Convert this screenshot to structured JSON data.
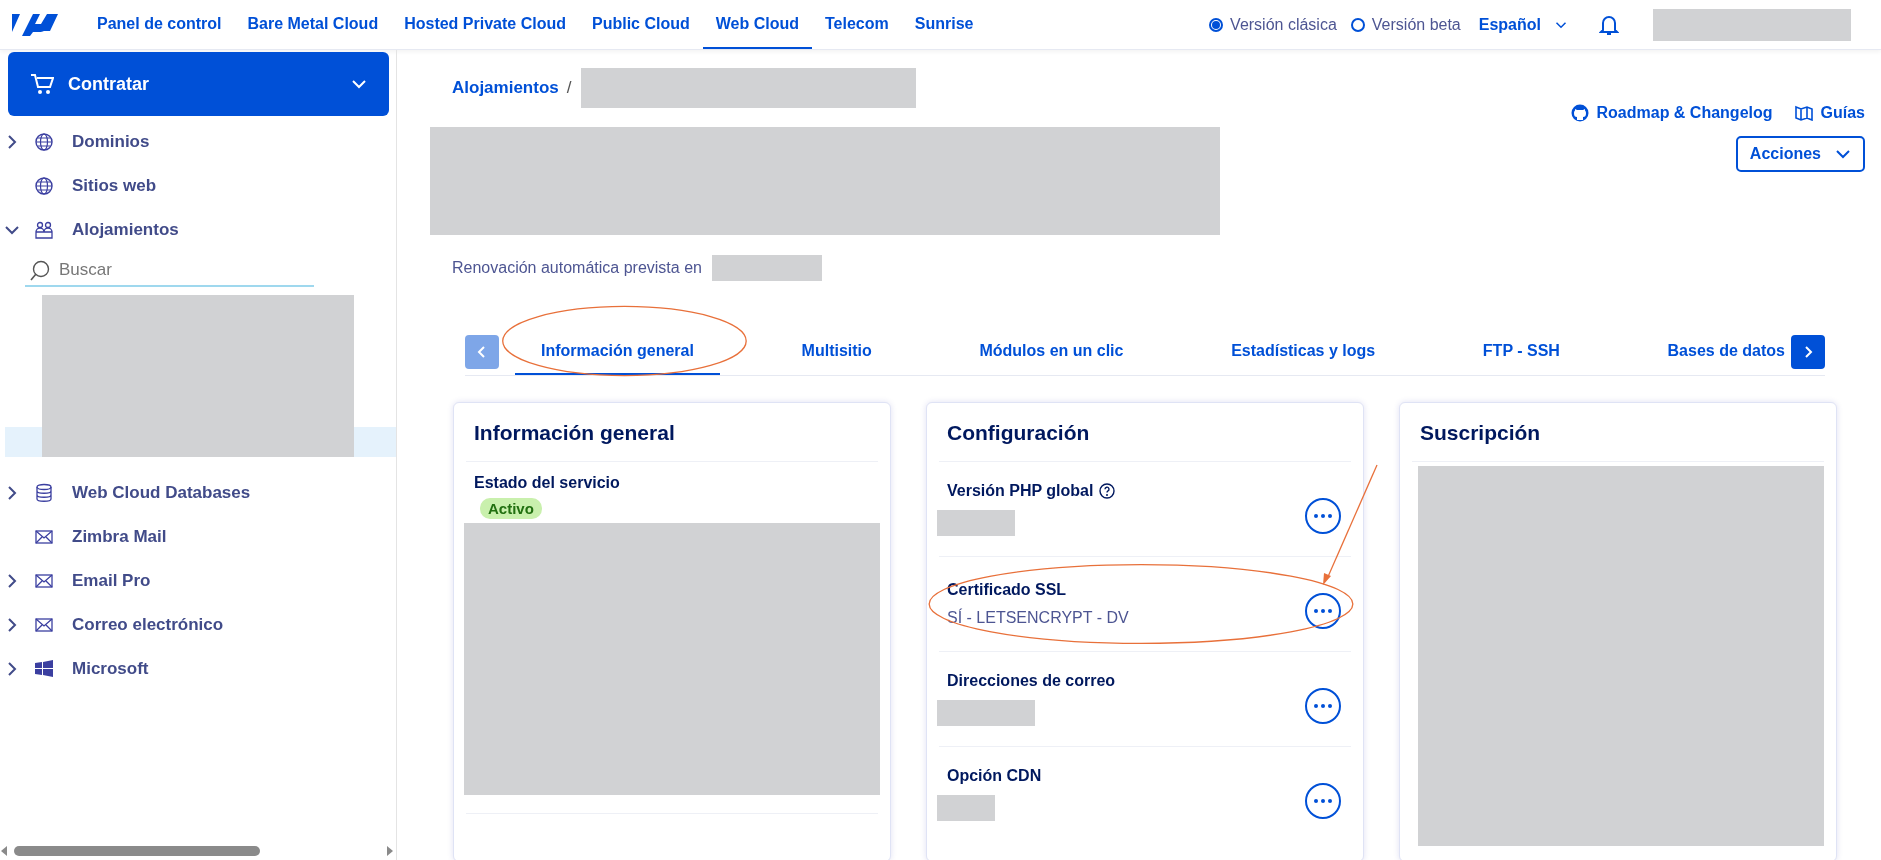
{
  "nav": {
    "items": [
      {
        "label": "Panel de control",
        "selected": false
      },
      {
        "label": "Bare Metal Cloud",
        "selected": false
      },
      {
        "label": "Hosted Private Cloud",
        "selected": false
      },
      {
        "label": "Public Cloud",
        "selected": false
      },
      {
        "label": "Web Cloud",
        "selected": true
      },
      {
        "label": "Telecom",
        "selected": false
      },
      {
        "label": "Sunrise",
        "selected": false
      }
    ],
    "version_options": [
      {
        "label": "Versión clásica",
        "selected": true
      },
      {
        "label": "Versión beta",
        "selected": false
      }
    ],
    "language": "Español"
  },
  "sidebar": {
    "order_button": "Contratar",
    "items": [
      {
        "label": "Dominios",
        "kind": "globe",
        "expandable": true,
        "expanded": false
      },
      {
        "label": "Sitios web",
        "kind": "globe",
        "expandable": false
      },
      {
        "label": "Alojamientos",
        "kind": "people",
        "expandable": true,
        "expanded": true,
        "search_placeholder": "Buscar"
      },
      {
        "label": "Web Cloud Databases",
        "kind": "database",
        "expandable": true,
        "expanded": false
      },
      {
        "label": "Zimbra Mail",
        "kind": "mail",
        "expandable": false
      },
      {
        "label": "Email Pro",
        "kind": "mail",
        "expandable": true,
        "expanded": false
      },
      {
        "label": "Correo electrónico",
        "kind": "mail",
        "expandable": true,
        "expanded": false
      },
      {
        "label": "Microsoft",
        "kind": "windows",
        "expandable": true,
        "expanded": false
      }
    ]
  },
  "header": {
    "breadcrumb": {
      "link": "Alojamientos",
      "separator": "/"
    },
    "links": [
      {
        "label": "Roadmap & Changelog",
        "kind": "github"
      },
      {
        "label": "Guías",
        "kind": "book"
      }
    ],
    "actions_button": "Acciones",
    "renewal_text": "Renovación automática prevista en"
  },
  "tabs": [
    {
      "label": "Información general",
      "selected": true,
      "circled": true
    },
    {
      "label": "Multisitio",
      "selected": false,
      "circled": false
    },
    {
      "label": "Módulos en un clic",
      "selected": false,
      "circled": false
    },
    {
      "label": "Estadísticas y logs",
      "selected": false,
      "circled": false
    },
    {
      "label": "FTP - SSH",
      "selected": false,
      "circled": false
    },
    {
      "label": "Bases de datos",
      "selected": false,
      "circled": false
    }
  ],
  "tab_scroll": {
    "prev_disabled": true,
    "next_disabled": false
  },
  "cards": [
    {
      "title": "Información general",
      "kind": "info",
      "rows": [
        {
          "label": "Estado del servicio",
          "status": "Activo"
        }
      ]
    },
    {
      "title": "Configuración",
      "kind": "config",
      "rows": [
        {
          "label": "Versión PHP global",
          "help": true,
          "circled": false
        },
        {
          "label": "Certificado SSL",
          "value": "SÍ - LETSENCRYPT - DV",
          "help": false,
          "circled": true
        },
        {
          "label": "Direcciones de correo",
          "help": false,
          "circled": false
        },
        {
          "label": "Opción CDN",
          "help": false,
          "circled": false
        }
      ]
    },
    {
      "title": "Suscripción",
      "kind": "subscription"
    }
  ]
}
